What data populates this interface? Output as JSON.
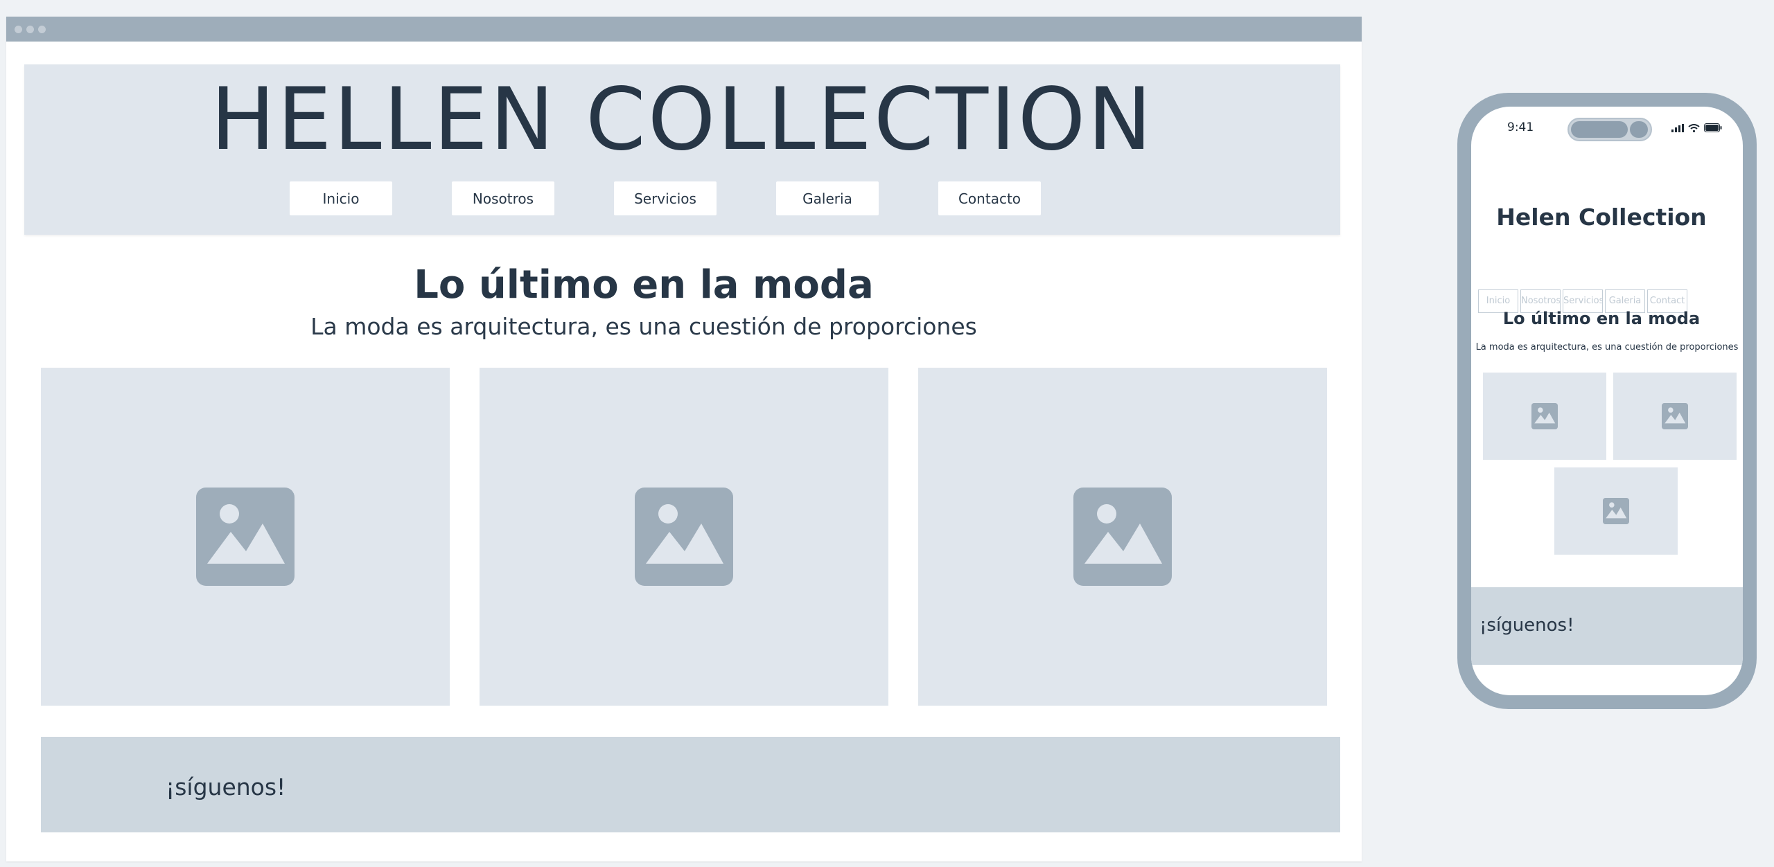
{
  "colors": {
    "page_background": "#eff2f5",
    "browser_bar": "#9eadba",
    "hero_background": "#e0e6ed",
    "text_dark": "#273646",
    "placeholder_background": "#e0e6ed",
    "placeholder_icon": "#9eadba",
    "footer_background": "#cdd7df",
    "phone_frame": "#9aabb9"
  },
  "desktop": {
    "hero": {
      "title": "HELLEN COLLECTION"
    },
    "nav": [
      {
        "label": "Inicio"
      },
      {
        "label": "Nosotros"
      },
      {
        "label": "Servicios"
      },
      {
        "label": "Galeria"
      },
      {
        "label": "Contacto"
      }
    ],
    "section": {
      "title": "Lo último en la moda",
      "subtitle": "La moda es arquitectura, es una cuestión de proporciones"
    },
    "gallery": [
      {
        "icon": "image-placeholder-icon"
      },
      {
        "icon": "image-placeholder-icon"
      },
      {
        "icon": "image-placeholder-icon"
      }
    ],
    "footer": {
      "text": "¡síguenos!"
    }
  },
  "mobile": {
    "status_bar": {
      "time": "9:41",
      "icons": [
        "signal-icon",
        "wifi-icon",
        "battery-icon"
      ]
    },
    "title": "Helen Collection",
    "nav": [
      {
        "label": "Inicio"
      },
      {
        "label": "Nosotros"
      },
      {
        "label": "Servicios"
      },
      {
        "label": "Galeria"
      },
      {
        "label": "Contact"
      }
    ],
    "section": {
      "title": "Lo último en la moda",
      "subtitle": "La moda es arquitectura, es una cuestión de proporciones"
    },
    "gallery": [
      {
        "icon": "image-placeholder-icon"
      },
      {
        "icon": "image-placeholder-icon"
      },
      {
        "icon": "image-placeholder-icon"
      }
    ],
    "footer": {
      "text": "¡síguenos!"
    }
  }
}
